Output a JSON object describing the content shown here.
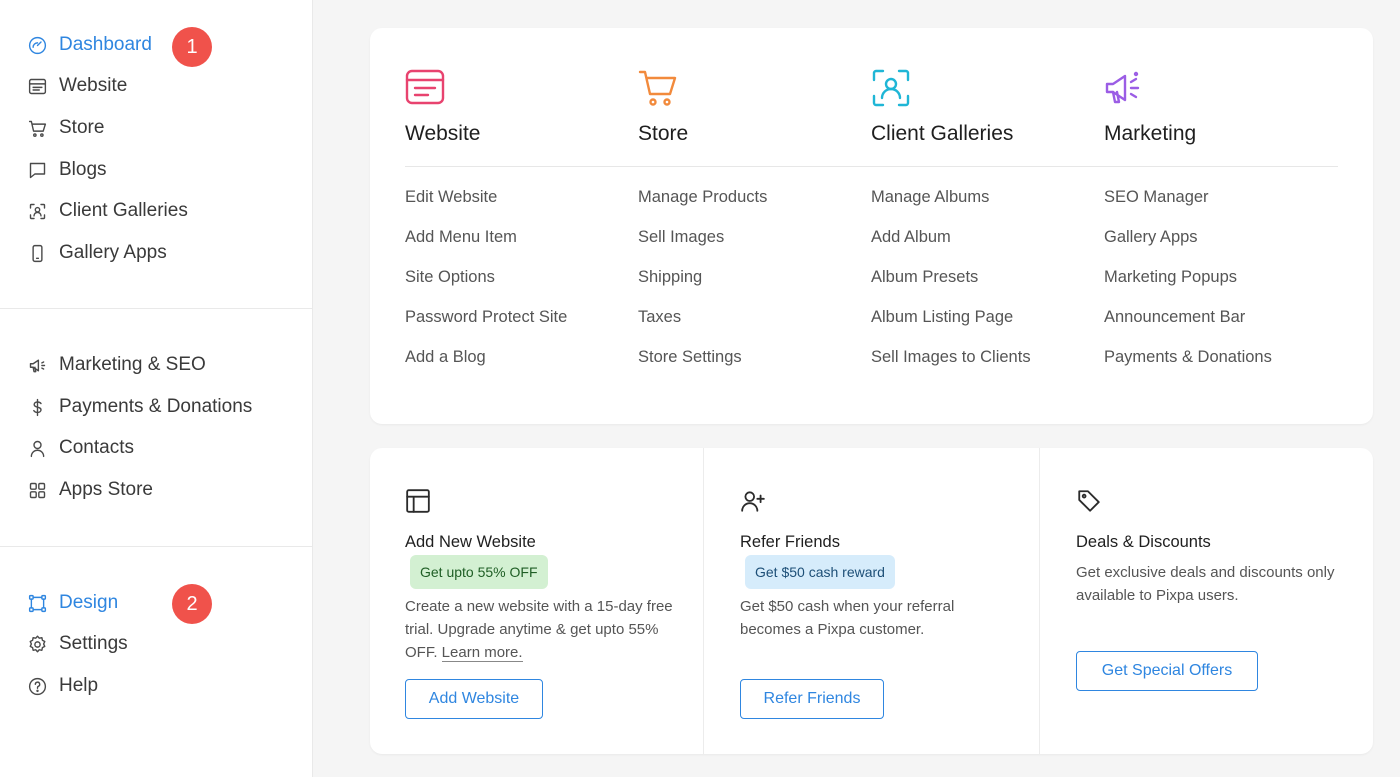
{
  "sidebar": {
    "group1": [
      {
        "label": "Dashboard",
        "icon": "gauge-icon",
        "active": true
      },
      {
        "label": "Website",
        "icon": "browser-icon"
      },
      {
        "label": "Store",
        "icon": "cart-icon"
      },
      {
        "label": "Blogs",
        "icon": "chat-icon"
      },
      {
        "label": "Client Galleries",
        "icon": "face-scan-icon"
      },
      {
        "label": "Gallery Apps",
        "icon": "phone-icon"
      }
    ],
    "group2": [
      {
        "label": "Marketing & SEO",
        "icon": "megaphone-icon"
      },
      {
        "label": "Payments & Donations",
        "icon": "dollar-icon"
      },
      {
        "label": "Contacts",
        "icon": "user-icon"
      },
      {
        "label": "Apps Store",
        "icon": "grid-icon"
      }
    ],
    "group3": [
      {
        "label": "Design",
        "icon": "vector-nodes-icon",
        "active": true
      },
      {
        "label": "Settings",
        "icon": "gear-icon"
      },
      {
        "label": "Help",
        "icon": "help-circle-icon"
      }
    ],
    "badges": [
      "1",
      "2"
    ]
  },
  "categories": [
    {
      "title": "Website",
      "icon": "browser-icon",
      "color": "#e8436f",
      "links": [
        "Edit Website",
        "Add Menu Item",
        "Site Options",
        "Password Protect Site",
        "Add a Blog"
      ]
    },
    {
      "title": "Store",
      "icon": "cart-icon",
      "color": "#f28a3c",
      "links": [
        "Manage Products",
        "Sell Images",
        "Shipping",
        "Taxes",
        "Store Settings"
      ]
    },
    {
      "title": "Client Galleries",
      "icon": "face-scan-icon",
      "color": "#1fb6d6",
      "links": [
        "Manage Albums",
        "Add Album",
        "Album Presets",
        "Album Listing Page",
        "Sell Images to Clients"
      ]
    },
    {
      "title": "Marketing",
      "icon": "megaphone-icon",
      "color": "#9b5de5",
      "links": [
        "SEO Manager",
        "Gallery Apps",
        "Marketing Popups",
        "Announcement Bar",
        "Payments & Donations"
      ]
    }
  ],
  "panels": {
    "website": {
      "icon": "layout-icon",
      "title": "Add New Website",
      "pill": "Get upto 55% OFF",
      "desc": "Create a new website with a 15-day free trial. Upgrade anytime & get upto 55% OFF.",
      "learn_more": "Learn more.",
      "button": "Add Website"
    },
    "refer": {
      "icon": "user-plus-icon",
      "title": "Refer Friends",
      "pill": "Get $50 cash reward",
      "desc": "Get $50 cash when your referral becomes a Pixpa customer.",
      "button": "Refer Friends"
    },
    "deals": {
      "icon": "tag-icon",
      "title": "Deals & Discounts",
      "desc": "Get exclusive deals and discounts only available to Pixpa users.",
      "button": "Get Special Offers"
    }
  },
  "colors": {
    "accent": "#2f86e0",
    "badge": "#f0524b"
  }
}
